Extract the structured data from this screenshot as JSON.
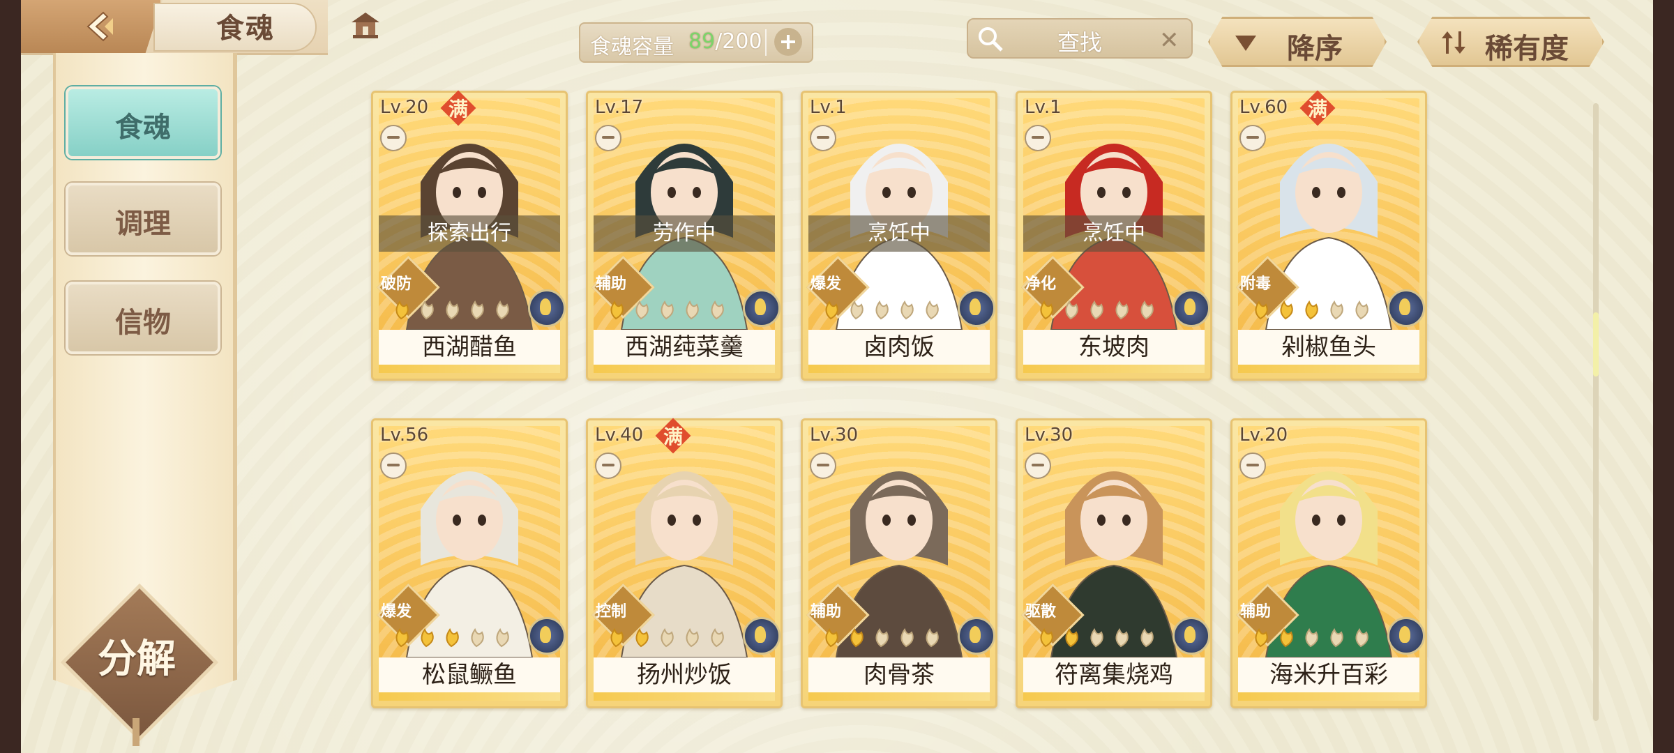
{
  "topbar": {
    "title": "食魂",
    "capacity_label": "食魂容量",
    "capacity_current": "89",
    "capacity_max": "/200",
    "search_placeholder": "查找",
    "sort_order": "降序",
    "sort_field": "稀有度"
  },
  "sidebar": {
    "tabs": [
      {
        "label": "食魂",
        "active": true
      },
      {
        "label": "调理",
        "active": false
      },
      {
        "label": "信物",
        "active": false
      }
    ],
    "decompose_label": "分解"
  },
  "cards": [
    {
      "level": "Lv.20",
      "max_badge": "满",
      "status": "探索出行",
      "role": "破防",
      "stars": 1,
      "name": "西湖醋鱼"
    },
    {
      "level": "Lv.17",
      "max_badge": "",
      "status": "劳作中",
      "role": "辅助",
      "stars": 1,
      "name": "西湖莼菜羹"
    },
    {
      "level": "Lv.1",
      "max_badge": "",
      "status": "烹饪中",
      "role": "爆发",
      "stars": 1,
      "name": "卤肉饭"
    },
    {
      "level": "Lv.1",
      "max_badge": "",
      "status": "烹饪中",
      "role": "净化",
      "stars": 1,
      "name": "东坡肉"
    },
    {
      "level": "Lv.60",
      "max_badge": "满",
      "status": "",
      "role": "附毒",
      "stars": 3,
      "name": "剁椒鱼头"
    },
    {
      "level": "Lv.56",
      "max_badge": "",
      "status": "",
      "role": "爆发",
      "stars": 3,
      "name": "松鼠鳜鱼"
    },
    {
      "level": "Lv.40",
      "max_badge": "满",
      "status": "",
      "role": "控制",
      "stars": 2,
      "name": "扬州炒饭"
    },
    {
      "level": "Lv.30",
      "max_badge": "",
      "status": "",
      "role": "辅助",
      "stars": 2,
      "name": "肉骨茶"
    },
    {
      "level": "Lv.30",
      "max_badge": "",
      "status": "",
      "role": "驱散",
      "stars": 2,
      "name": "符离集烧鸡"
    },
    {
      "level": "Lv.20",
      "max_badge": "",
      "status": "",
      "role": "辅助",
      "stars": 2,
      "name": "海米升百彩"
    }
  ],
  "colors": {
    "accent_green": "#7cd46a",
    "max_badge_red": "#e04d2d",
    "active_tab_teal": "#86d0c6"
  }
}
